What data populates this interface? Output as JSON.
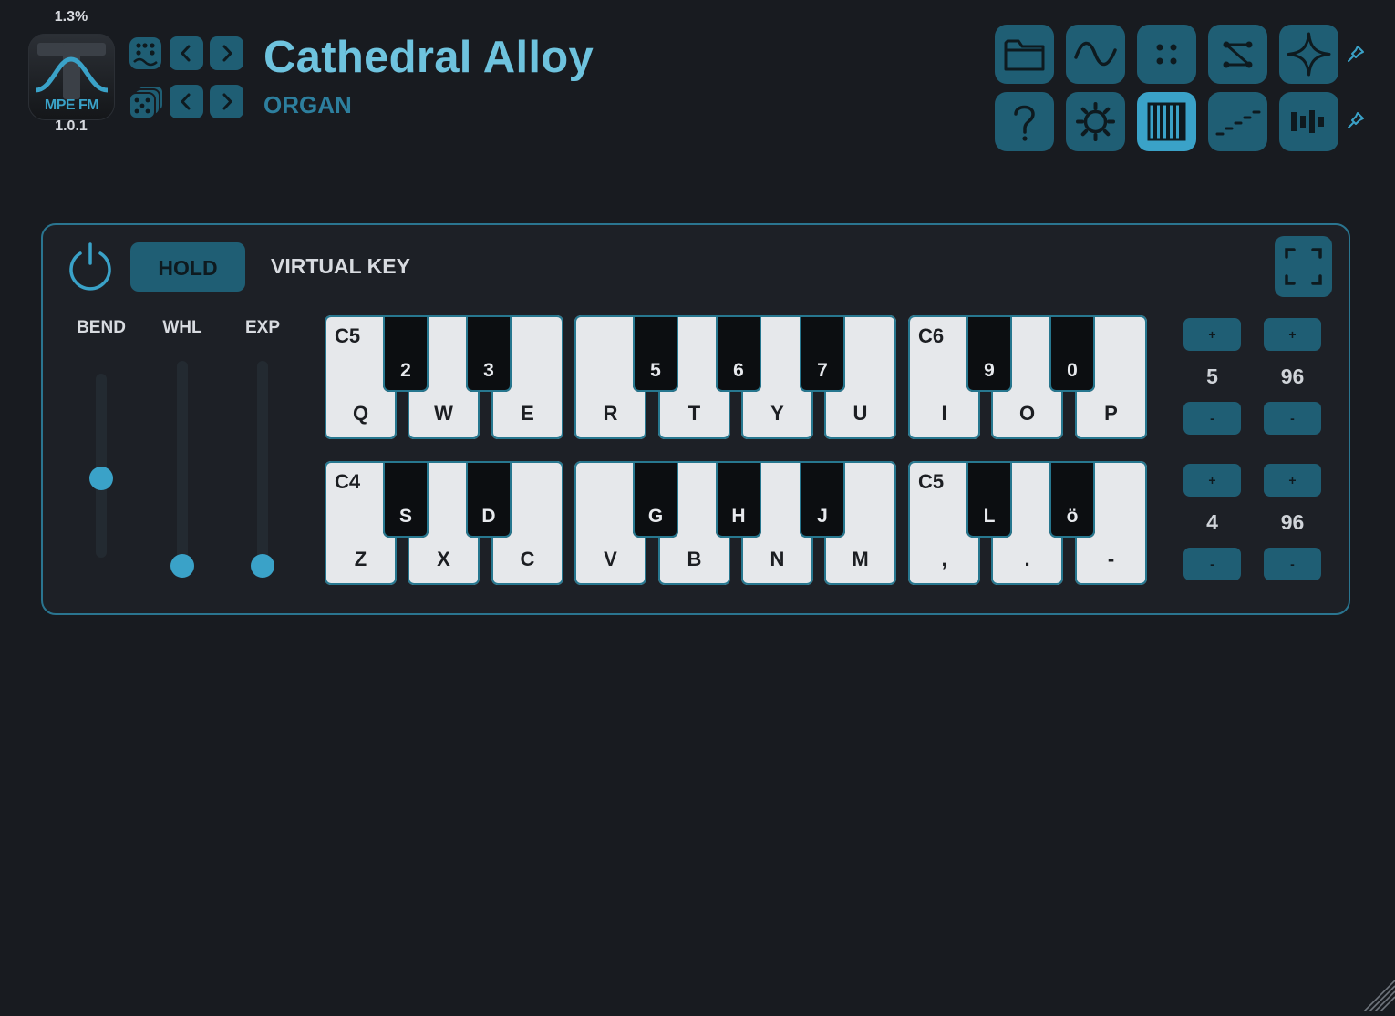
{
  "header": {
    "cpu_usage": "1.3%",
    "logo_text": "MPE FM",
    "version": "1.0.1",
    "preset_name": "Cathedral Alloy",
    "preset_category": "ORGAN"
  },
  "preset_nav": {
    "row1": [
      "random-dice-icon",
      "chevron-left-icon",
      "chevron-right-icon"
    ],
    "row2": [
      "random-dice-stack-icon",
      "chevron-left-icon",
      "chevron-right-icon"
    ]
  },
  "toolbar": {
    "row1": [
      "folder-icon",
      "wave-icon",
      "dots-icon",
      "matrix-icon",
      "sparkle-icon",
      "pin-icon"
    ],
    "row2": [
      "help-icon",
      "gear-icon",
      "keyboard-icon",
      "steps-icon",
      "bars-icon",
      "pin-icon"
    ],
    "active": "keyboard-icon"
  },
  "keyboard_panel": {
    "title": "VIRTUAL KEY",
    "hold_label": "HOLD",
    "sliders": [
      {
        "label": "BEND",
        "value": 0.5
      },
      {
        "label": "WHL",
        "value": 0.0
      },
      {
        "label": "EXP",
        "value": 0.0
      }
    ],
    "rows": [
      {
        "octave_labels": [
          "C5",
          "C6"
        ],
        "white_keys": [
          "Q",
          "W",
          "E",
          "R",
          "T",
          "Y",
          "U",
          "I",
          "O",
          "P"
        ],
        "black_keys": [
          "2",
          "3",
          "5",
          "6",
          "7",
          "9",
          "0"
        ],
        "octave_value": "5",
        "velocity_value": "96"
      },
      {
        "octave_labels": [
          "C4",
          "C5"
        ],
        "white_keys": [
          "Z",
          "X",
          "C",
          "V",
          "B",
          "N",
          "M",
          ",",
          ".",
          "-"
        ],
        "black_keys": [
          "S",
          "D",
          "G",
          "H",
          "J",
          "L",
          "ö"
        ],
        "octave_value": "4",
        "velocity_value": "96"
      }
    ],
    "plus_label": "+",
    "minus_label": "-"
  },
  "colors": {
    "accent": "#3aa2c8",
    "button": "#1f5e74",
    "background": "#181b20",
    "title": "#6ec3de"
  }
}
